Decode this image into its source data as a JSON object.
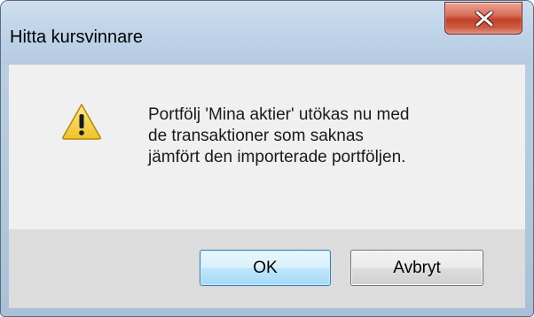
{
  "dialog": {
    "title": "Hitta kursvinnare",
    "message_lines": [
      "Portfölj 'Mina aktier' utökas nu med",
      "de transaktioner som saknas",
      "jämfört den importerade portföljen."
    ],
    "icon": "warning-icon",
    "close_icon": "close-icon"
  },
  "buttons": {
    "ok_label": "OK",
    "cancel_label": "Avbryt"
  },
  "colors": {
    "frame": "#b9cde3",
    "close_button": "#c7452c",
    "warning_fill": "#f5d33f",
    "content_background": "#f0f0f0",
    "button_area_background": "#dcdcdc",
    "ok_border": "#3c7fb1"
  }
}
